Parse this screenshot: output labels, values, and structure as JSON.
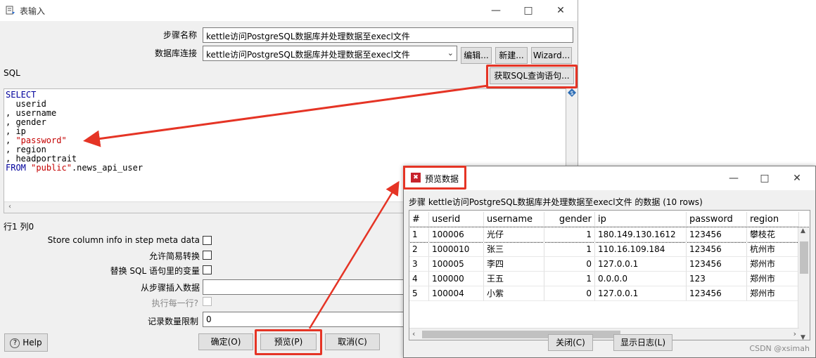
{
  "main_window": {
    "title": "表输入",
    "fields": {
      "step_name_label": "步骤名称",
      "step_name_value": "kettle访问PostgreSQL数据库并处理数据至execl文件",
      "db_conn_label": "数据库连接",
      "db_conn_value": "kettle访问PostgreSQL数据库并处理数据至execl文件"
    },
    "buttons": {
      "edit": "编辑...",
      "new": "新建...",
      "wizard": "Wizard...",
      "get_sql": "获取SQL查询语句...",
      "help": "Help",
      "ok": "确定(O)",
      "preview": "预览(P)",
      "cancel": "取消(C)"
    },
    "sql_label": "SQL",
    "sql_lines": {
      "l1": "SELECT",
      "l2": "  userid",
      "l3": ", username",
      "l4": ", gender",
      "l5": ", ip",
      "l6_prefix": ", ",
      "l6_str": "\"password\"",
      "l7": ", region",
      "l8": ", headportrait",
      "l9_kw": "FROM",
      "l9_str": "\"public\"",
      "l9_rest": ".news_api_user"
    },
    "cursor_pos": "行1 列0",
    "options": {
      "store_meta": "Store column info in step meta data",
      "lazy_conv": "允许简易转换",
      "replace_vars": "替换 SQL 语句里的变量",
      "insert_from": "从步骤插入数据",
      "exec_each": "执行每一行?",
      "limit_label": "记录数量限制",
      "limit_value": "0"
    }
  },
  "preview_window": {
    "title": "预览数据",
    "subtitle": "步骤 kettle访问PostgreSQL数据库并处理数据至execl文件 的数据  (10 rows)",
    "columns": [
      "#",
      "userid",
      "username",
      "gender",
      "ip",
      "password",
      "region"
    ],
    "rows": [
      [
        "1",
        "100006",
        "光仔",
        "1",
        "180.149.130.1612",
        "123456",
        "攀枝花"
      ],
      [
        "2",
        "1000010",
        "张三",
        "1",
        "110.16.109.184",
        "123456",
        "杭州市"
      ],
      [
        "3",
        "100005",
        "李四",
        "0",
        "127.0.0.1",
        "123456",
        "郑州市"
      ],
      [
        "4",
        "100000",
        "王五",
        "1",
        "0.0.0.0",
        "123",
        "郑州市"
      ],
      [
        "5",
        "100004",
        "小紫",
        "0",
        "127.0.0.1",
        "123456",
        "郑州市"
      ]
    ],
    "buttons": {
      "close": "关闭(C)",
      "log": "显示日志(L)"
    }
  },
  "watermark": "CSDN @xsimah",
  "colors": {
    "highlight_red": "#e53425",
    "sql_keyword": "#00009b",
    "sql_string": "#c40000"
  }
}
